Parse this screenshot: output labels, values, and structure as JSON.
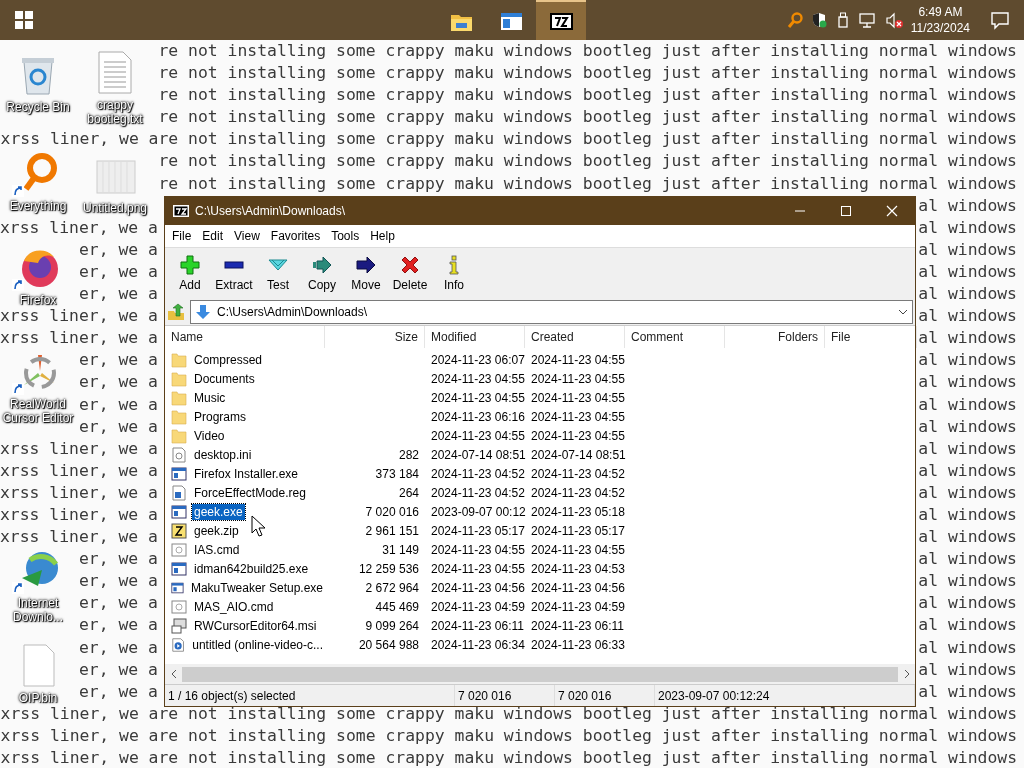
{
  "taskbar": {
    "apps": [
      {
        "kind": "folder",
        "selected": false
      },
      {
        "kind": "window",
        "selected": false
      },
      {
        "kind": "archiver",
        "selected": true
      }
    ],
    "clock": {
      "time": "6:49 AM",
      "date": "11/23/2024"
    }
  },
  "wallpaper": {
    "lines": [
      {
        "kind": "full",
        "text": "re not installing some crappy maku windows bootleg just after installing normal windows"
      },
      {
        "kind": "full",
        "text": "re not installing some crappy maku windows bootleg just after installing normal windows"
      },
      {
        "kind": "full",
        "text": "re not installing some crappy maku windows bootleg just after installing normal windows"
      },
      {
        "kind": "full",
        "text": "re not installing some crappy maku windows bootleg just after installing normal windows"
      },
      {
        "kind": "full",
        "text": "xrss liner, we are not installing some crappy maku windows bootleg just after installing normal windows"
      },
      {
        "kind": "full",
        "text": "re not installing some crappy maku windows bootleg just after installing normal windows"
      },
      {
        "kind": "full",
        "text": "re not installing some crappy maku windows bootleg just after installing normal windows"
      },
      {
        "kind": "split",
        "right": "al windows"
      },
      {
        "kind": "split",
        "left": "xrss liner, we a",
        "right": "al windows"
      },
      {
        "kind": "split",
        "left": "er, we a",
        "right": "al windows"
      },
      {
        "kind": "split",
        "left": "er, we a",
        "right": "al windows"
      },
      {
        "kind": "split",
        "left": "er, we a",
        "right": "al windows"
      },
      {
        "kind": "split",
        "left": "xrss liner, we a",
        "right": "al windows"
      },
      {
        "kind": "split",
        "left": "xrss liner, we a",
        "right": "al windows"
      },
      {
        "kind": "split",
        "left": "er, we a",
        "right": "al windows"
      },
      {
        "kind": "split",
        "left": "er, we a",
        "right": "al windows"
      },
      {
        "kind": "split",
        "left": "er, we a",
        "right": "al windows"
      },
      {
        "kind": "split",
        "left": "er, we a",
        "right": "al windows"
      },
      {
        "kind": "split",
        "left": "xrss liner, we a",
        "right": "al windows"
      },
      {
        "kind": "split",
        "left": "xrss liner, we a",
        "right": "al windows"
      },
      {
        "kind": "split",
        "left": "xrss liner, we a",
        "right": "al windows"
      },
      {
        "kind": "split",
        "left": "xrss liner, we a",
        "right": "al windows"
      },
      {
        "kind": "split",
        "left": "xrss liner, we a",
        "right": "al windows"
      },
      {
        "kind": "split",
        "left": "er, we a",
        "right": "al windows"
      },
      {
        "kind": "split",
        "left": "er, we a",
        "right": "al windows"
      },
      {
        "kind": "split",
        "left": "er, we a",
        "right": "al windows"
      },
      {
        "kind": "split",
        "left": "er, we a",
        "right": "al windows"
      },
      {
        "kind": "split",
        "left": "er, we a",
        "right": "al windows"
      },
      {
        "kind": "split",
        "left": "er, we a",
        "right": "al windows"
      },
      {
        "kind": "split",
        "left": "er, we a",
        "right": "al windows"
      },
      {
        "kind": "full",
        "text": "xrss liner, we are not installing some crappy maku windows bootleg just after installing normal windows"
      },
      {
        "kind": "full",
        "text": "xrss liner, we are not installing some crappy maku windows bootleg just after installing normal windows"
      },
      {
        "kind": "full",
        "text": "xrss liner, we are not installing some crappy maku windows bootleg just after installing normal windows"
      }
    ]
  },
  "desktop": {
    "icons": [
      {
        "label": "Recycle Bin",
        "kind": "recycle",
        "shortcut": false
      },
      {
        "label": "crappy bootleg.txt",
        "kind": "text-file",
        "shortcut": false
      },
      {
        "label": "Everything",
        "kind": "search-app",
        "shortcut": true
      },
      {
        "label": "Untitled.png",
        "kind": "image-file",
        "shortcut": false
      },
      {
        "label": "Firefox",
        "kind": "browser",
        "shortcut": true
      },
      {
        "label": "RealWorld Cursor Editor",
        "kind": "cursor-app",
        "shortcut": true
      },
      {
        "label": "Internet Downlo...",
        "kind": "download-app",
        "shortcut": true
      },
      {
        "label": "OIP.bin",
        "kind": "blank-file",
        "shortcut": false
      }
    ]
  },
  "window": {
    "title": "C:\\Users\\Admin\\Downloads\\",
    "menu": [
      "File",
      "Edit",
      "View",
      "Favorites",
      "Tools",
      "Help"
    ],
    "toolbar": [
      {
        "label": "Add",
        "kind": "add"
      },
      {
        "label": "Extract",
        "kind": "extract"
      },
      {
        "label": "Test",
        "kind": "test"
      },
      {
        "label": "Copy",
        "kind": "copy"
      },
      {
        "label": "Move",
        "kind": "move"
      },
      {
        "label": "Delete",
        "kind": "delete"
      },
      {
        "label": "Info",
        "kind": "info"
      }
    ],
    "address": "C:\\Users\\Admin\\Downloads\\",
    "columns": [
      "Name",
      "Size",
      "Modified",
      "Created",
      "Comment",
      "Folders",
      "File"
    ],
    "rows": [
      {
        "name": "Compressed",
        "kind": "folder",
        "modified": "2024-11-23 06:07",
        "created": "2024-11-23 04:55",
        "selected": false
      },
      {
        "name": "Documents",
        "kind": "folder",
        "modified": "2024-11-23 04:55",
        "created": "2024-11-23 04:55",
        "selected": false
      },
      {
        "name": "Music",
        "kind": "folder",
        "modified": "2024-11-23 04:55",
        "created": "2024-11-23 04:55",
        "selected": false
      },
      {
        "name": "Programs",
        "kind": "folder",
        "modified": "2024-11-23 06:16",
        "created": "2024-11-23 04:55",
        "selected": false
      },
      {
        "name": "Video",
        "kind": "folder",
        "modified": "2024-11-23 04:55",
        "created": "2024-11-23 04:55",
        "selected": false
      },
      {
        "name": "desktop.ini",
        "kind": "settings",
        "size": "282",
        "modified": "2024-07-14 08:51",
        "created": "2024-07-14 08:51",
        "selected": false
      },
      {
        "name": "Firefox Installer.exe",
        "kind": "program",
        "size": "373 184",
        "modified": "2024-11-23 04:52",
        "created": "2024-11-23 04:52",
        "selected": false
      },
      {
        "name": "ForceEffectMode.reg",
        "kind": "registry",
        "size": "264",
        "modified": "2024-11-23 04:52",
        "created": "2024-11-23 04:52",
        "selected": false
      },
      {
        "name": "geek.exe",
        "kind": "program",
        "size": "7 020 016",
        "modified": "2023-09-07 00:12",
        "created": "2024-11-23 05:18",
        "selected": true
      },
      {
        "name": "geek.zip",
        "kind": "archive",
        "size": "2 961 151",
        "modified": "2024-11-23 05:17",
        "created": "2024-11-23 05:17",
        "selected": false
      },
      {
        "name": "IAS.cmd",
        "kind": "script",
        "size": "31 149",
        "modified": "2024-11-23 04:55",
        "created": "2024-11-23 04:55",
        "selected": false
      },
      {
        "name": "idman642build25.exe",
        "kind": "program",
        "size": "12 259 536",
        "modified": "2024-11-23 04:55",
        "created": "2024-11-23 04:53",
        "selected": false
      },
      {
        "name": "MakuTweaker Setup.exe",
        "kind": "program",
        "size": "2 672 964",
        "modified": "2024-11-23 04:56",
        "created": "2024-11-23 04:56",
        "selected": false
      },
      {
        "name": "MAS_AIO.cmd",
        "kind": "script",
        "size": "445 469",
        "modified": "2024-11-23 04:59",
        "created": "2024-11-23 04:59",
        "selected": false
      },
      {
        "name": "RWCursorEditor64.msi",
        "kind": "installer",
        "size": "9 099 264",
        "modified": "2024-11-23 06:11",
        "created": "2024-11-23 06:11",
        "selected": false
      },
      {
        "name": "untitled (online-video-c...",
        "kind": "media",
        "size": "20 564 988",
        "modified": "2024-11-23 06:34",
        "created": "2024-11-23 06:33",
        "selected": false
      }
    ],
    "status": [
      "1 / 16 object(s) selected",
      "7 020 016",
      "7 020 016",
      "2023-09-07 00:12:24"
    ]
  }
}
